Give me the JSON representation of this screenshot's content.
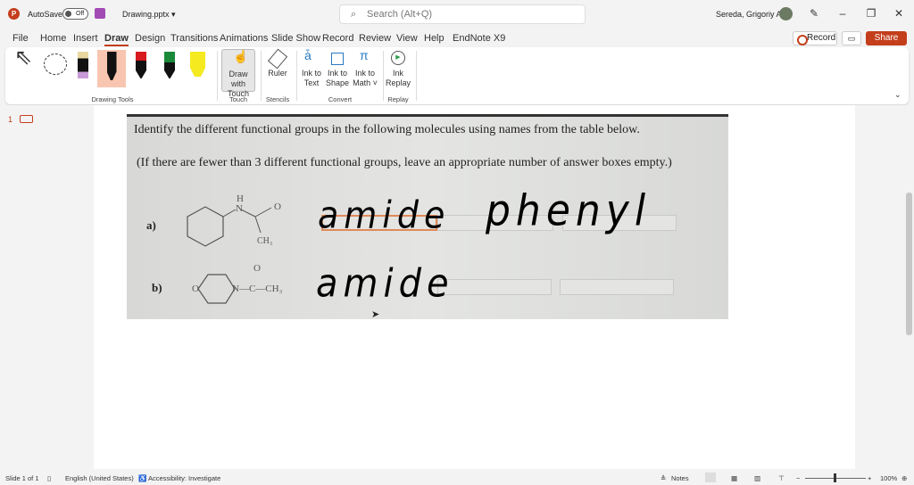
{
  "titlebar": {
    "app_letter": "P",
    "autosave": "AutoSave",
    "toggle": "Off",
    "filename": "Drawing.pptx ▾",
    "search_placeholder": "Search (Alt+Q)",
    "user": "Sereda, Grigoriy A"
  },
  "tabs": [
    "File",
    "Home",
    "Insert",
    "Draw",
    "Design",
    "Transitions",
    "Animations",
    "Slide Show",
    "Record",
    "Review",
    "View",
    "Help",
    "EndNote X9"
  ],
  "actions": {
    "record": "Record",
    "share": "Share"
  },
  "ribbon": {
    "groups": [
      "Drawing Tools",
      "Touch",
      "Stencils",
      "Convert",
      "Replay"
    ],
    "draw_with_touch": "Draw with Touch",
    "ruler": "Ruler",
    "ink_to_text": "Ink to Text",
    "ink_to_shape": "Ink to Shape",
    "ink_to_math": "Ink to Math ˅",
    "ink_replay": "Ink Replay"
  },
  "thumb": {
    "number": "1"
  },
  "slide": {
    "line1": "Identify the different functional groups in the following molecules using names from the table below.",
    "line2": "(If there are fewer than 3 different functional groups, leave an appropriate number of answer boxes empty.)",
    "label_a": "a)",
    "label_b": "b)",
    "mol_a": {
      "h": "H",
      "n": "N",
      "o": "O",
      "ch3": "CH₃"
    },
    "mol_b": {
      "o_ring": "O",
      "chain": "N—C—CH₃",
      "o": "O"
    },
    "ink": {
      "a1": "amide",
      "a2": "phenyl",
      "b1": "amide"
    }
  },
  "status": {
    "slide": "Slide 1 of 1",
    "language": "English (United States)",
    "accessibility": "Accessibility: Investigate",
    "notes": "Notes",
    "zoom": "100%"
  },
  "colors": {
    "accent": "#c43e1c",
    "highlight": "#e08a5a"
  }
}
